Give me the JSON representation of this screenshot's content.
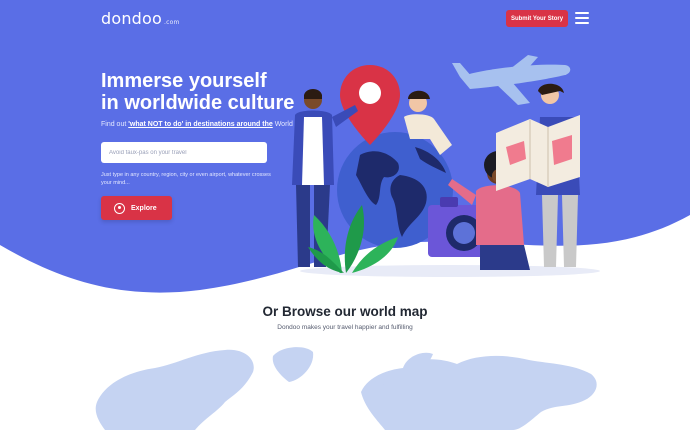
{
  "header": {
    "logo_text": "dondoo",
    "logo_suffix": ".com",
    "submit_label": "Submit Your Story",
    "menu_icon": "hamburger-menu-icon"
  },
  "hero": {
    "title_line1": "Immerse yourself",
    "title_line2": "in worldwide culture",
    "subtitle_prefix": "Find out ",
    "subtitle_highlight": "'what NOT to do' in destinations around the",
    "subtitle_suffix": " World",
    "search_placeholder": "Avoid faux-pas on your travel",
    "hint": "Just type in any country, region, city or even airport, whatever crosses your mind...",
    "explore_label": "Explore",
    "explore_icon": "compass-icon"
  },
  "browse": {
    "title": "Or Browse our world map",
    "subtitle": "Dondoo makes your travel happier and fulfilling"
  },
  "colors": {
    "hero_bg": "#5a6ee6",
    "accent": "#d93346",
    "map_land": "#c5d3f2",
    "white": "#ffffff"
  }
}
